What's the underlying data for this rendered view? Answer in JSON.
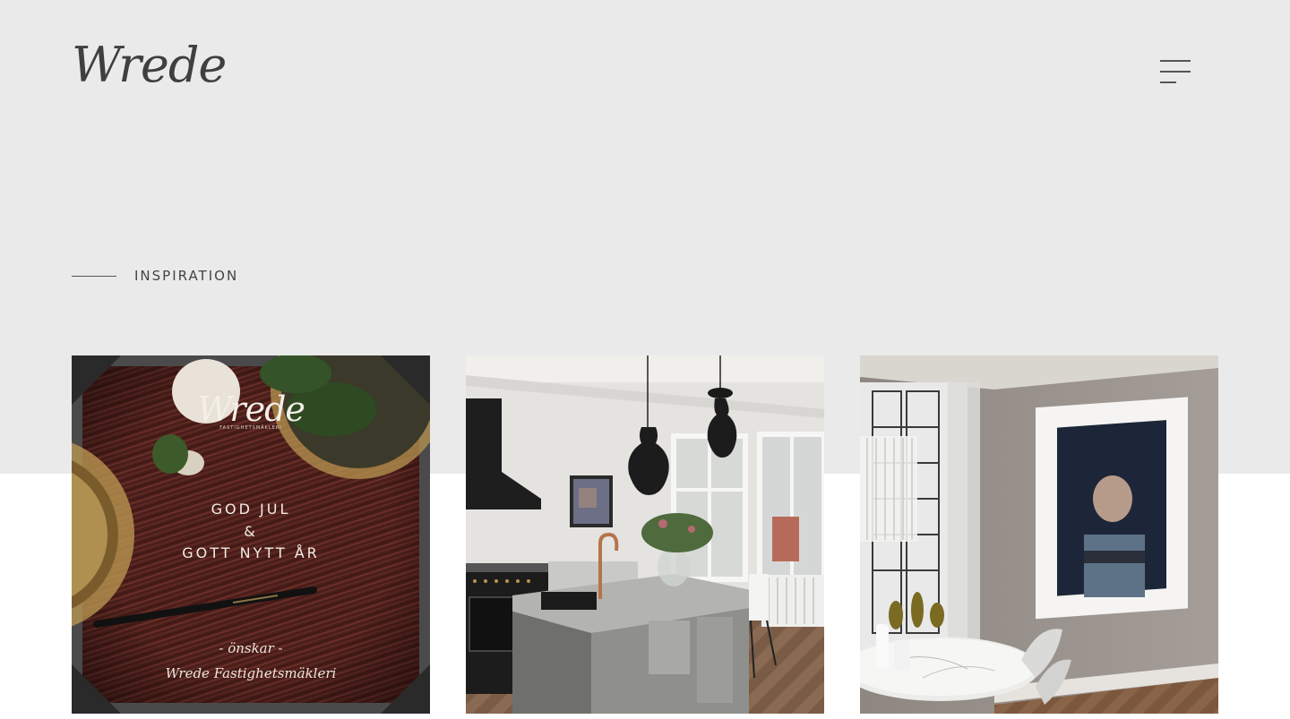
{
  "header": {
    "logo_text": "Wrede",
    "menu_icon": "hamburger-menu-icon"
  },
  "section": {
    "title": "INSPIRATION"
  },
  "cards": [
    {
      "type": "holiday-card",
      "logo_text": "Wrede",
      "logo_subtitle": "FASTIGHETSMÄKLERI",
      "greeting": [
        "GOD JUL",
        "&",
        "GOTT NYTT ÅR"
      ],
      "signature": [
        "- önskar -",
        "Wrede Fastighetsmäkleri"
      ]
    },
    {
      "type": "kitchen-photo"
    },
    {
      "type": "dining-room-photo"
    }
  ],
  "colors": {
    "band": "#eaeaea",
    "text_dark": "#444444"
  }
}
